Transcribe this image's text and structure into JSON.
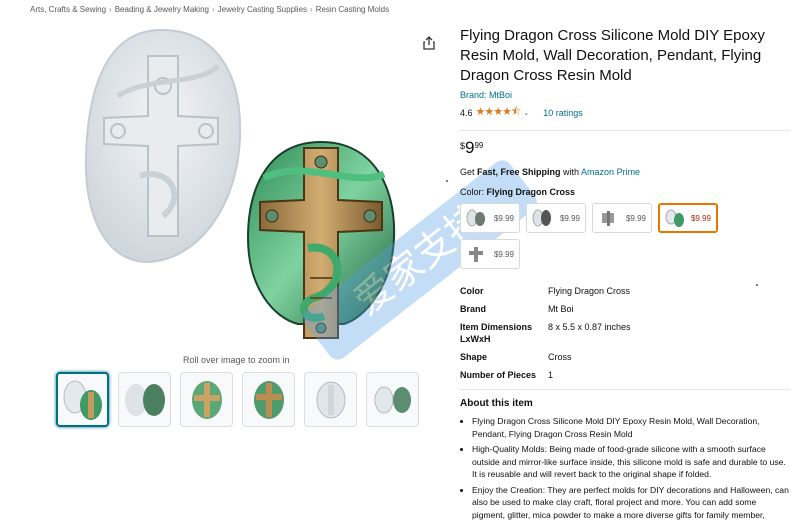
{
  "breadcrumb": [
    "Arts, Crafts & Sewing",
    "Beading & Jewelry Making",
    "Jewelry Casting Supplies",
    "Resin Casting Molds"
  ],
  "gallery": {
    "zoom_hint": "Roll over image to zoom in",
    "thumbnail_count": 6
  },
  "product": {
    "title": "Flying Dragon Cross Silicone Mold DIY Epoxy Resin Mold, Wall Decoration, Pendant, Flying Dragon Cross Resin Mold",
    "brand": "Brand: MtBoi",
    "rating": "4.6",
    "ratings_count": "10 ratings",
    "price": {
      "symbol": "$",
      "whole": "9",
      "fraction": "99"
    },
    "shipping": {
      "prefix": "Get ",
      "fast": "Fast, Free Shipping",
      "with": " with ",
      "prime": "Amazon Prime"
    },
    "color_label": "Color: ",
    "color_value": "Flying Dragon Cross",
    "swatches": [
      {
        "price": "$9.99",
        "selected": false
      },
      {
        "price": "$9.99",
        "selected": false
      },
      {
        "price": "$9.99",
        "selected": false
      },
      {
        "price": "$9.99",
        "selected": true
      },
      {
        "price": "$9.99",
        "selected": false
      }
    ]
  },
  "specs": [
    {
      "key": "Color",
      "value": "Flying Dragon Cross"
    },
    {
      "key": "Brand",
      "value": "Mt Boi"
    },
    {
      "key": "Item Dimensions LxWxH",
      "value": "8 x 5.5 x 0.87 inches"
    },
    {
      "key": "Shape",
      "value": "Cross"
    },
    {
      "key": "Number of Pieces",
      "value": "1"
    }
  ],
  "about": {
    "title": "About this item",
    "bullets": [
      "Flying Dragon Cross Silicone Mold DIY Epoxy Resin Mold, Wall Decoration, Pendant, Flying Dragon Cross Resin Mold",
      "High-Quality Molds: Being made of food-grade silicone with a smooth surface outside and mirror-like surface inside, this silicone mold is safe and durable to use. It is reusable and will revert back to the original shape if folded.",
      "Enjoy the Creation: They are perfect molds for DIY decorations and Halloween, can also be used to make clay craft, floral project and more. You can add some pigment, glitter, mica powder to make a more diverse gifts for family member, friends and lover or use it to enjoy the fun time to create an amazing resin craft!"
    ]
  },
  "colors": {
    "link": "#007185",
    "star": "#de7921",
    "selected_border": "#e77600",
    "sale_price": "#b12704"
  },
  "watermark_text": "爱家支持"
}
